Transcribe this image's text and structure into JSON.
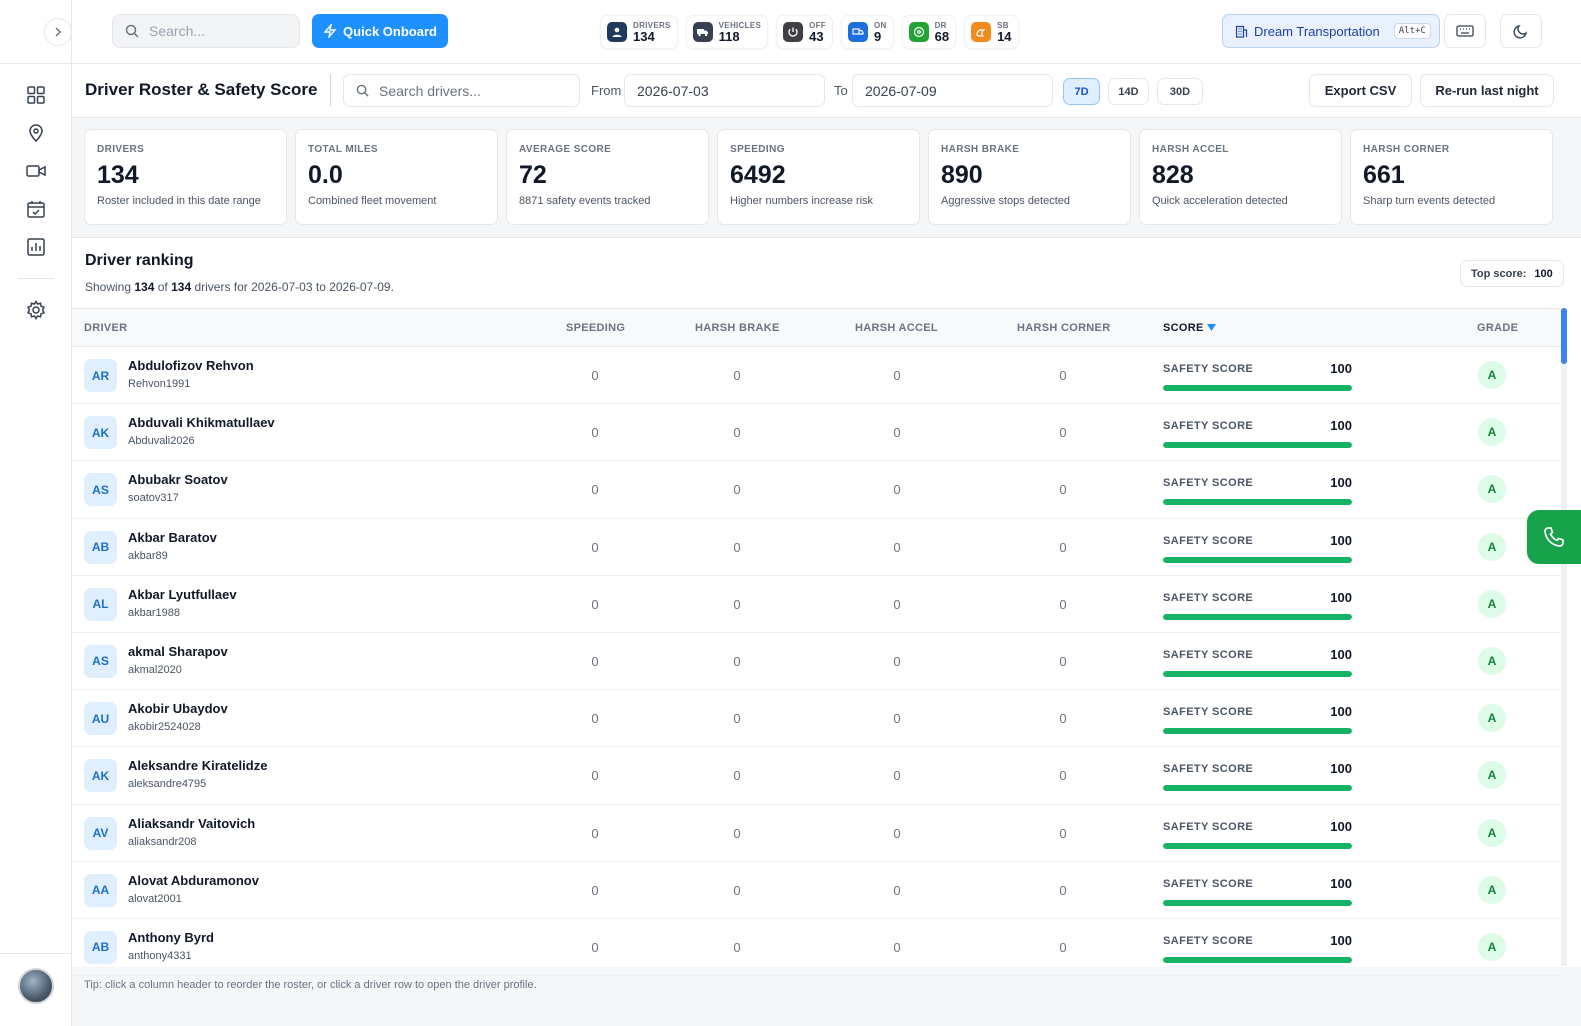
{
  "topbar": {
    "search_placeholder": "Search...",
    "quick_onboard_label": "Quick Onboard",
    "stats": [
      {
        "label": "DRIVERS",
        "value": "134",
        "color": "#1f3a5f"
      },
      {
        "label": "VEHICLES",
        "value": "118",
        "color": "#374151"
      },
      {
        "label": "OFF",
        "value": "43",
        "color": "#3f3f46"
      },
      {
        "label": "ON",
        "value": "9",
        "color": "#1d6fe0"
      },
      {
        "label": "DR",
        "value": "68",
        "color": "#22a335"
      },
      {
        "label": "SB",
        "value": "14",
        "color": "#f28b1e"
      }
    ],
    "org_name": "Dream Transportation",
    "org_shortcut": "Alt+C"
  },
  "page": {
    "title": "Driver Roster & Safety Score",
    "search_placeholder": "Search drivers...",
    "from_label": "From",
    "from_date": "2026-07-03",
    "to_label": "To",
    "to_date": "2026-07-09",
    "ranges": [
      "7D",
      "14D",
      "30D"
    ],
    "active_range": "7D",
    "export_label": "Export CSV",
    "rerun_label": "Re-run last night"
  },
  "metrics": [
    {
      "label": "DRIVERS",
      "value": "134",
      "sub": "Roster included in this date range"
    },
    {
      "label": "TOTAL MILES",
      "value": "0.0",
      "sub": "Combined fleet movement"
    },
    {
      "label": "AVERAGE SCORE",
      "value": "72",
      "sub": "8871 safety events tracked"
    },
    {
      "label": "SPEEDING",
      "value": "6492",
      "sub": "Higher numbers increase risk"
    },
    {
      "label": "HARSH BRAKE",
      "value": "890",
      "sub": "Aggressive stops detected"
    },
    {
      "label": "HARSH ACCEL",
      "value": "828",
      "sub": "Quick acceleration detected"
    },
    {
      "label": "HARSH CORNER",
      "value": "661",
      "sub": "Sharp turn events detected"
    }
  ],
  "ranking": {
    "title": "Driver ranking",
    "sub_prefix": "Showing ",
    "shown": "134",
    "sub_of": " of ",
    "total": "134",
    "sub_suffix": " drivers for 2026-07-03 to 2026-07-09.",
    "top_score_label": "Top score:",
    "top_score_value": "100",
    "columns": {
      "driver": "DRIVER",
      "speeding": "SPEEDING",
      "harsh_brake": "HARSH BRAKE",
      "harsh_accel": "HARSH ACCEL",
      "harsh_corner": "HARSH CORNER",
      "score": "SCORE",
      "grade": "GRADE"
    },
    "score_label": "SAFETY SCORE",
    "drivers": [
      {
        "initials": "AR",
        "name": "Abdulofizov Rehvon",
        "username": "Rehvon1991",
        "speeding": "0",
        "brake": "0",
        "accel": "0",
        "corner": "0",
        "score": "100",
        "score_pct": 100,
        "grade": "A"
      },
      {
        "initials": "AK",
        "name": "Abduvali Khikmatullaev",
        "username": "Abduvali2026",
        "speeding": "0",
        "brake": "0",
        "accel": "0",
        "corner": "0",
        "score": "100",
        "score_pct": 100,
        "grade": "A"
      },
      {
        "initials": "AS",
        "name": "Abubakr Soatov",
        "username": "soatov317",
        "speeding": "0",
        "brake": "0",
        "accel": "0",
        "corner": "0",
        "score": "100",
        "score_pct": 100,
        "grade": "A"
      },
      {
        "initials": "AB",
        "name": "Akbar Baratov",
        "username": "akbar89",
        "speeding": "0",
        "brake": "0",
        "accel": "0",
        "corner": "0",
        "score": "100",
        "score_pct": 100,
        "grade": "A"
      },
      {
        "initials": "AL",
        "name": "Akbar Lyutfullaev",
        "username": "akbar1988",
        "speeding": "0",
        "brake": "0",
        "accel": "0",
        "corner": "0",
        "score": "100",
        "score_pct": 100,
        "grade": "A"
      },
      {
        "initials": "AS",
        "name": "akmal Sharapov",
        "username": "akmal2020",
        "speeding": "0",
        "brake": "0",
        "accel": "0",
        "corner": "0",
        "score": "100",
        "score_pct": 100,
        "grade": "A"
      },
      {
        "initials": "AU",
        "name": "Akobir Ubaydov",
        "username": "akobir2524028",
        "speeding": "0",
        "brake": "0",
        "accel": "0",
        "corner": "0",
        "score": "100",
        "score_pct": 100,
        "grade": "A"
      },
      {
        "initials": "AK",
        "name": "Aleksandre Kiratelidze",
        "username": "aleksandre4795",
        "speeding": "0",
        "brake": "0",
        "accel": "0",
        "corner": "0",
        "score": "100",
        "score_pct": 100,
        "grade": "A"
      },
      {
        "initials": "AV",
        "name": "Aliaksandr Vaitovich",
        "username": "aliaksandr208",
        "speeding": "0",
        "brake": "0",
        "accel": "0",
        "corner": "0",
        "score": "100",
        "score_pct": 100,
        "grade": "A"
      },
      {
        "initials": "AA",
        "name": "Alovat Abduramonov",
        "username": "alovat2001",
        "speeding": "0",
        "brake": "0",
        "accel": "0",
        "corner": "0",
        "score": "100",
        "score_pct": 100,
        "grade": "A"
      },
      {
        "initials": "AB",
        "name": "Anthony Byrd",
        "username": "anthony4331",
        "speeding": "0",
        "brake": "0",
        "accel": "0",
        "corner": "0",
        "score": "100",
        "score_pct": 100,
        "grade": "A"
      }
    ]
  },
  "tip": "Tip: click a column header to reorder the roster, or click a driver row to open the driver profile.",
  "colors": {
    "accent": "#1e90ff",
    "score_bar": "#16b364",
    "call": "#16a34a"
  }
}
